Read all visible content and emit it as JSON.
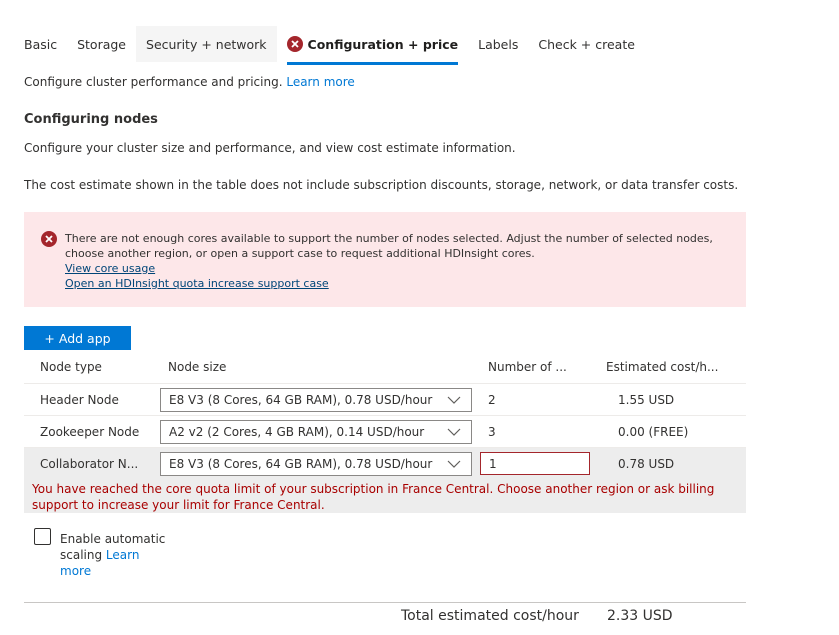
{
  "tabs": [
    {
      "label": "Basic",
      "state": "normal"
    },
    {
      "label": "Storage",
      "state": "normal"
    },
    {
      "label": "Security + network",
      "state": "hover"
    },
    {
      "label": "Configuration + price",
      "state": "active",
      "icon": "error-icon"
    },
    {
      "label": "Labels",
      "state": "normal"
    },
    {
      "label": "Check + create",
      "state": "normal"
    }
  ],
  "intro": {
    "text": "Configure cluster performance and pricing.",
    "link": "Learn more"
  },
  "section": {
    "title": "Configuring nodes",
    "description": "Configure your cluster size and performance, and view cost estimate information.",
    "disclaimer": "The cost estimate shown in the table does not include subscription discounts, storage, network, or data transfer costs."
  },
  "error_banner": {
    "icon": "error-icon",
    "message": "There are not enough cores available to support the number of nodes selected. Adjust the number of selected nodes, choose another region, or open a support case to request additional HDInsight cores.",
    "links": [
      "View core usage ",
      "Open an HDInsight quota increase support case"
    ]
  },
  "add_app_button": "+ Add app",
  "table": {
    "headers": [
      "Node type",
      "Node size",
      "Number of ...",
      "Estimated cost/h..."
    ],
    "rows": [
      {
        "node_type": "Header Node",
        "node_size": "E8 V3 (8 Cores, 64 GB RAM), 0.78 USD/hour",
        "count": "2",
        "cost": "1.55 USD"
      },
      {
        "node_type": "Zookeeper Node",
        "node_size": "A2 v2 (2 Cores, 4 GB RAM), 0.14 USD/hour",
        "count": "3",
        "cost": "0.00 (FREE)"
      },
      {
        "node_type": "Collaborator N...",
        "node_size": "E8 V3 (8 Cores, 64 GB RAM), 0.78 USD/hour",
        "count": "1",
        "cost": "0.78 USD",
        "error": "You have reached the core quota limit of your subscription in France Central. Choose another region or ask billing support to increase your limit for France Central."
      }
    ]
  },
  "autoscale": {
    "checked": false,
    "label": "Enable automatic scaling",
    "link": "Learn more"
  },
  "total": {
    "label": "Total estimated cost/hour",
    "value": "2.33 USD"
  },
  "colors": {
    "accent": "#0078d4",
    "error": "#a4262c",
    "error_text": "#a80000",
    "error_banner_bg": "#fde7e9"
  }
}
